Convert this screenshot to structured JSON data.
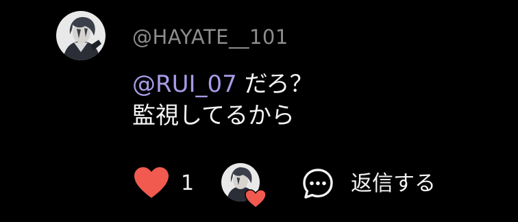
{
  "comment": {
    "username": "@HAYATE__101",
    "mention": "@RUI_07",
    "text_after_mention": " だろ？",
    "text_line2": "監視してるから"
  },
  "actions": {
    "like_count": "1",
    "reply_label": "返信する"
  },
  "colors": {
    "background": "#000000",
    "username": "#8d8d8d",
    "mention": "#a99be6",
    "heart": "#f05a4f",
    "text": "#f4f4f4"
  },
  "icons": {
    "like": "heart-icon",
    "reply": "speech-bubble-icon",
    "liked_badge": "heart-badge-icon"
  }
}
